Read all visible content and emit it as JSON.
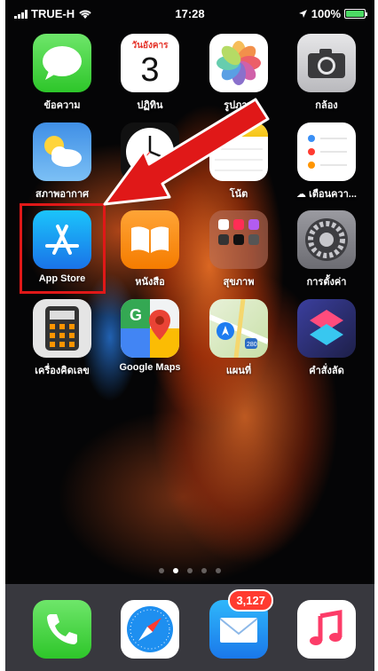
{
  "status_bar": {
    "carrier": "TRUE-H",
    "time": "17:28",
    "battery": "100%",
    "battery_level": 1.0
  },
  "apps": [
    {
      "id": "messages",
      "label": "ข้อความ",
      "icon": "messages-icon"
    },
    {
      "id": "calendar",
      "label": "ปฏิทิน",
      "icon": "calendar-icon",
      "weekday": "วันอังคาร",
      "day": "3"
    },
    {
      "id": "photos",
      "label": "รูปภาพ",
      "icon": "photos-icon"
    },
    {
      "id": "camera",
      "label": "กล้อง",
      "icon": "camera-icon"
    },
    {
      "id": "weather",
      "label": "สภาพอากาศ",
      "icon": "weather-icon"
    },
    {
      "id": "clock",
      "label": "นาฬิกา",
      "icon": "clock-icon"
    },
    {
      "id": "notes",
      "label": "โน้ต",
      "icon": "notes-icon"
    },
    {
      "id": "reminders",
      "label": "เตือนควา...",
      "icon": "reminders-icon"
    },
    {
      "id": "app-store",
      "label": "App Store",
      "icon": "app-store-icon"
    },
    {
      "id": "books",
      "label": "หนังสือ",
      "icon": "books-icon"
    },
    {
      "id": "health-folder",
      "label": "สุขภาพ",
      "icon": "folder-icon"
    },
    {
      "id": "settings",
      "label": "การตั้งค่า",
      "icon": "gear-icon"
    },
    {
      "id": "calculator",
      "label": "เครื่องคิดเลข",
      "icon": "calculator-icon"
    },
    {
      "id": "google-maps",
      "label": "Google Maps",
      "icon": "google-maps-icon"
    },
    {
      "id": "maps",
      "label": "แผนที่",
      "icon": "maps-icon"
    },
    {
      "id": "shortcuts",
      "label": "คำสั่งลัด",
      "icon": "shortcuts-icon"
    }
  ],
  "page_dots": {
    "count": 5,
    "active": 1
  },
  "dock": [
    {
      "id": "phone",
      "icon": "phone-icon"
    },
    {
      "id": "safari",
      "icon": "safari-icon"
    },
    {
      "id": "mail",
      "icon": "mail-icon",
      "badge": "3,127"
    },
    {
      "id": "music",
      "icon": "music-icon"
    }
  ],
  "colors": {
    "highlight": "#e01818",
    "arrow": "#e01818",
    "badge": "#ff3b30"
  }
}
